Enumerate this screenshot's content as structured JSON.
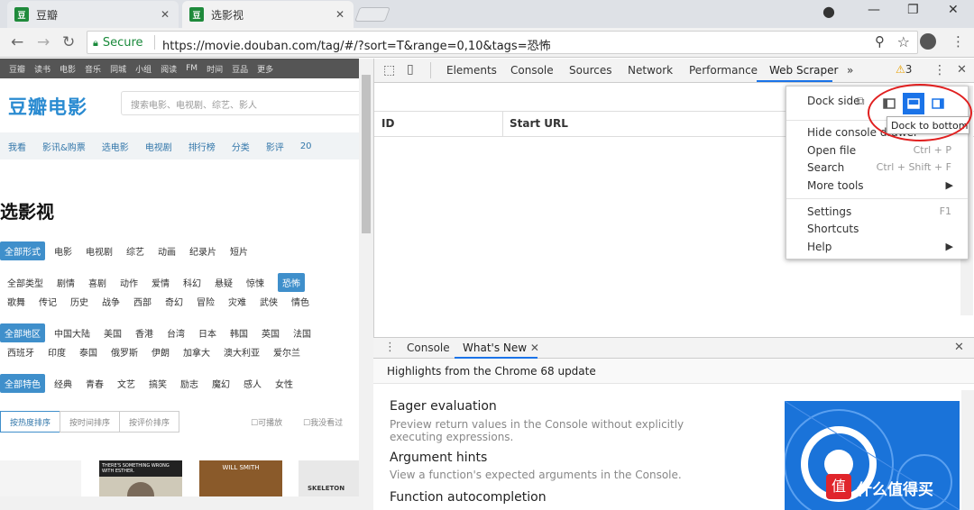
{
  "browser": {
    "tabs": [
      {
        "title": "豆瓣",
        "favicon": "豆"
      },
      {
        "title": "选影视",
        "favicon": "豆"
      }
    ],
    "secure_label": "Secure",
    "url": "https://movie.douban.com/tag/#/?sort=T&range=0,10&tags=恐怖"
  },
  "page": {
    "topnav": [
      "豆瓣",
      "读书",
      "电影",
      "音乐",
      "同城",
      "小组",
      "阅读",
      "FM",
      "时间",
      "豆品",
      "更多"
    ],
    "logo": "豆瓣电影",
    "search_placeholder": "搜索电影、电视剧、综艺、影人",
    "subnav": [
      "我看",
      "影讯&购票",
      "选电影",
      "电视剧",
      "排行榜",
      "分类",
      "影评",
      "20"
    ],
    "title": "选影视",
    "rows": [
      [
        "全部形式",
        "电影",
        "电视剧",
        "综艺",
        "动画",
        "纪录片",
        "短片"
      ],
      [
        "全部类型",
        "剧情",
        "喜剧",
        "动作",
        "爱情",
        "科幻",
        "悬疑",
        "惊悚",
        "恐怖"
      ],
      [
        "歌舞",
        "传记",
        "历史",
        "战争",
        "西部",
        "奇幻",
        "冒险",
        "灾难",
        "武侠",
        "情色"
      ],
      [
        "全部地区",
        "中国大陆",
        "美国",
        "香港",
        "台湾",
        "日本",
        "韩国",
        "英国",
        "法国"
      ],
      [
        "西班牙",
        "印度",
        "泰国",
        "俄罗斯",
        "伊朗",
        "加拿大",
        "澳大利亚",
        "爱尔兰"
      ],
      [
        "全部特色",
        "经典",
        "青春",
        "文艺",
        "搞笑",
        "励志",
        "魔幻",
        "感人",
        "女性"
      ]
    ],
    "sort": [
      "按热度排序",
      "按时间排序",
      "按评价排序"
    ],
    "filters": [
      "可播放",
      "我没看过"
    ],
    "poster_texts": [
      "THERE'S SOMETHING WRONG WITH ESTHER.",
      "WILL SMITH",
      "SKELETON"
    ]
  },
  "devtools": {
    "tabs": [
      "Elements",
      "Console",
      "Sources",
      "Network",
      "Performance",
      "Web Scraper",
      "»"
    ],
    "warning_count": "3",
    "columns": [
      "ID",
      "Start URL"
    ],
    "menu": {
      "dock_side": "Dock side",
      "items": [
        {
          "label": "Hide console drawer",
          "key": ""
        },
        {
          "label": "Open file",
          "key": "Ctrl + P"
        },
        {
          "label": "Search",
          "key": "Ctrl + Shift + F"
        },
        {
          "label": "More tools",
          "key": "▶"
        },
        {
          "label": "Settings",
          "key": "F1"
        },
        {
          "label": "Shortcuts",
          "key": ""
        },
        {
          "label": "Help",
          "key": "▶"
        }
      ]
    },
    "tooltip": "Dock to bottom",
    "drawer": {
      "tabs": [
        "Console",
        "What's New"
      ],
      "heading": "Highlights from the Chrome 68 update",
      "features": [
        {
          "title": "Eager evaluation",
          "desc": "Preview return values in the Console without explicitly executing expressions."
        },
        {
          "title": "Argument hints",
          "desc": "View a function's expected arguments in the Console."
        },
        {
          "title": "Function autocompletion",
          "desc": ""
        }
      ]
    }
  },
  "watermark": "什么值得买",
  "colors": {
    "accent": "#1a73e8",
    "douban_green": "#1f8a3b",
    "douban_blue": "#3f8fcb",
    "annotation": "#e02020"
  }
}
